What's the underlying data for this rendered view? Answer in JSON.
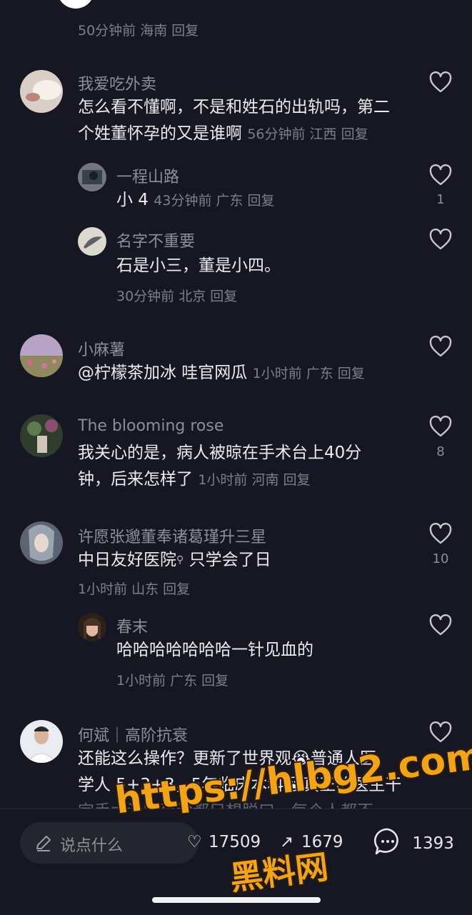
{
  "top_meta": "50分钟前 海南 回复",
  "comments": [
    {
      "user": "我爱吃外卖",
      "text_line1": "怎么看不懂啊，不是和姓石的出轨吗，第二",
      "text_line2": "个姓董怀孕的又是谁啊",
      "meta": "56分钟前 江西 回复",
      "replies": [
        {
          "user": "一程山路",
          "text": "小 4",
          "meta": "43分钟前 广东 回复",
          "likes": "1"
        },
        {
          "user": "名字不重要",
          "text": "石是小三，董是小四。",
          "meta": "30分钟前 北京 回复"
        }
      ]
    },
    {
      "user": "小麻薯",
      "text": "@柠檬茶加冰 哇官网瓜",
      "meta": "1小时前 广东 回复"
    },
    {
      "user": "The blooming rose",
      "text_line1": "我关心的是，病人被晾在手术台上40分",
      "text_line2": "钟，后来怎样了",
      "meta": "1小时前 河南 回复",
      "likes": "8"
    },
    {
      "user": "许愿张邈董奉诸葛瑾升三星",
      "text": "中日友好医院",
      "text_tail": " 只学会了日",
      "meta": "1小时前 山东 回复",
      "likes": "10",
      "replies": [
        {
          "user": "春末",
          "text": "哈哈哈哈哈哈哈一针见血的",
          "meta": "1小时前 广东 回复"
        }
      ]
    },
    {
      "user": "何斌｜高阶抗衰",
      "text_line1": "还能这么操作？更新了世界观",
      "text_line1b": "普通人医",
      "text_line2": "学人 5+3+3，5年临床本科",
      "text_line2b": "真正的医生干",
      "text_line3": "完手术治疗再诊都只想脱口，每个人都不"
    }
  ],
  "bottom": {
    "input_placeholder": "说点什么",
    "likes": "17509",
    "shares": "1679",
    "comments": "1393"
  },
  "watermark": {
    "line1": "https://hlbg2.com",
    "line2": "黑料网"
  },
  "colors": {
    "background": "#161723",
    "watermark": "#f2a316",
    "muted_text": "#8d8e96"
  }
}
